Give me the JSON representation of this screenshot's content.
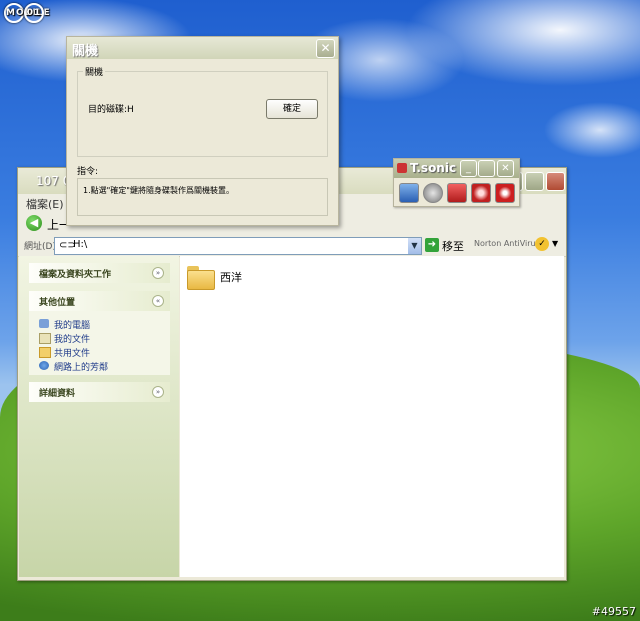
{
  "watermark": {
    "brand": "MOBILE",
    "brand_suffix": "01"
  },
  "post_id": "#49557",
  "explorer": {
    "title": "107 0",
    "menu": "檔案(E)",
    "back_label": "上一",
    "address_label": "網址(D)",
    "address_value": "H:\\",
    "go_label": "移至",
    "norton_label": "Norton AntiVirus",
    "left_panels": [
      {
        "title": "檔案及資料夾工作",
        "chevron": "»"
      },
      {
        "title": "其他位置",
        "chevron": "«",
        "links": [
          "我的電腦",
          "我的文件",
          "共用文件",
          "網路上的芳鄰"
        ]
      },
      {
        "title": "詳細資料",
        "chevron": "»"
      }
    ],
    "folder_name": "西洋"
  },
  "tsonic": {
    "title": "T.sonic"
  },
  "dialog": {
    "title": "關機",
    "group_label": "關機",
    "drive_label": "目的磁碟:H",
    "ok_button": "確定",
    "instruction_label": "指令:",
    "instruction_text": "1.點選\"確定\"鍵將隨身碟製作爲關機裝置。"
  }
}
